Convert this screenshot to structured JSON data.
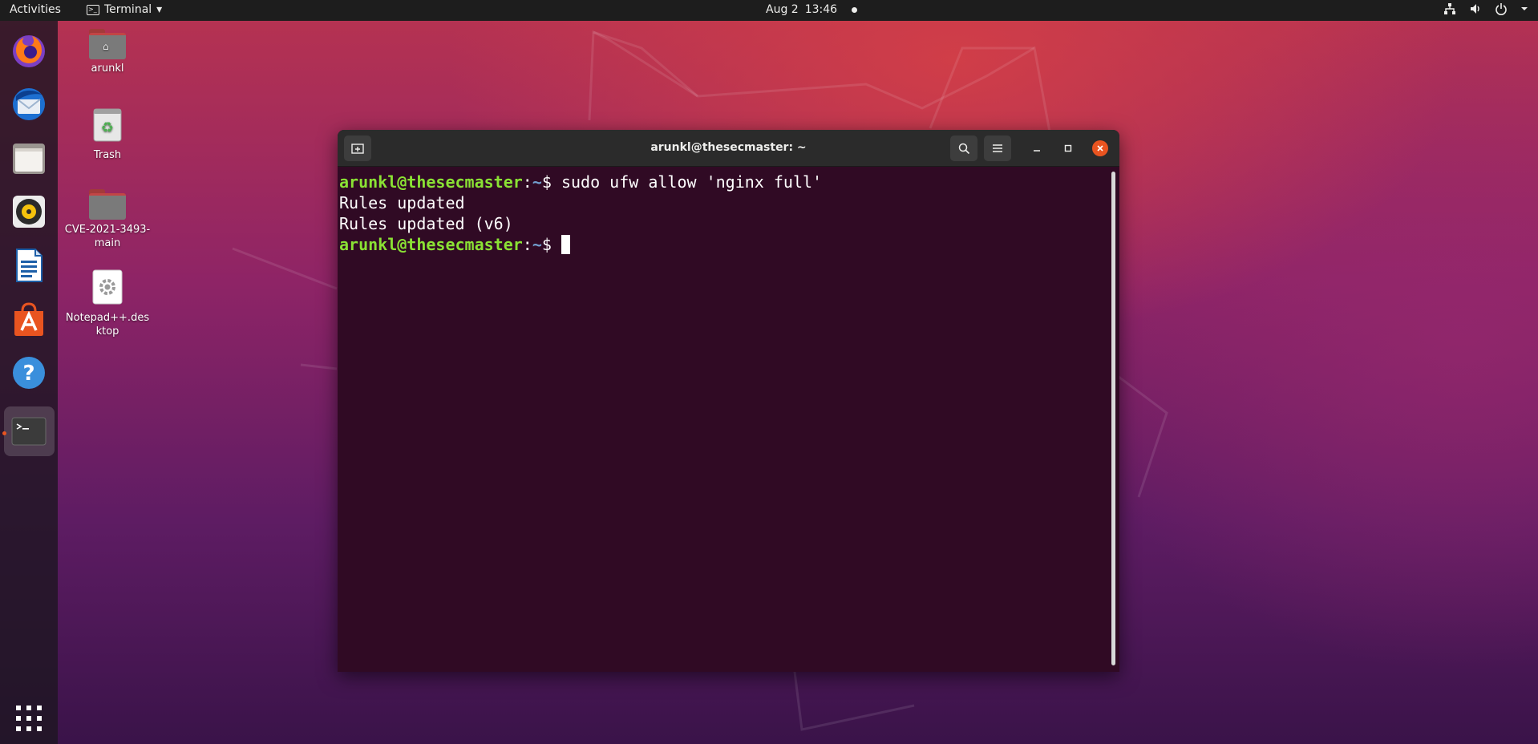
{
  "topbar": {
    "activities": "Activities",
    "app_name": "Terminal",
    "app_menu_arrow": "▾",
    "date": "Aug 2",
    "time": "13:46",
    "icons": [
      "network-icon",
      "volume-icon",
      "power-icon",
      "chevron-down-icon"
    ]
  },
  "dock": {
    "items": [
      {
        "name": "firefox-icon"
      },
      {
        "name": "thunderbird-icon"
      },
      {
        "name": "files-icon"
      },
      {
        "name": "rhythmbox-icon"
      },
      {
        "name": "libreoffice-writer-icon"
      },
      {
        "name": "ubuntu-software-icon"
      },
      {
        "name": "help-icon"
      },
      {
        "name": "terminal-icon",
        "running": true
      }
    ],
    "show_apps": "show-applications-icon"
  },
  "desktop": {
    "icons": [
      {
        "label": "arunkl",
        "type": "home-folder"
      },
      {
        "label": "Trash",
        "type": "trash"
      },
      {
        "label": "CVE-2021-3493-main",
        "type": "folder"
      },
      {
        "label": "Notepad++.desktop",
        "type": "desktop-file"
      }
    ]
  },
  "terminal": {
    "title": "arunkl@thesecmaster: ~",
    "lines": [
      {
        "user": "arunkl@thesecmaster",
        "sep": ":",
        "dir": "~",
        "prompt": "$ ",
        "cmd": "sudo ufw allow 'nginx full'"
      },
      {
        "text": "Rules updated"
      },
      {
        "text": "Rules updated (v6)"
      },
      {
        "user": "arunkl@thesecmaster",
        "sep": ":",
        "dir": "~",
        "prompt": "$ ",
        "cmd": ""
      }
    ]
  },
  "colors": {
    "prompt_user": "#8ae234",
    "prompt_dir": "#729fcf",
    "terminal_bg": "#300a24",
    "accent": "#e95420"
  }
}
